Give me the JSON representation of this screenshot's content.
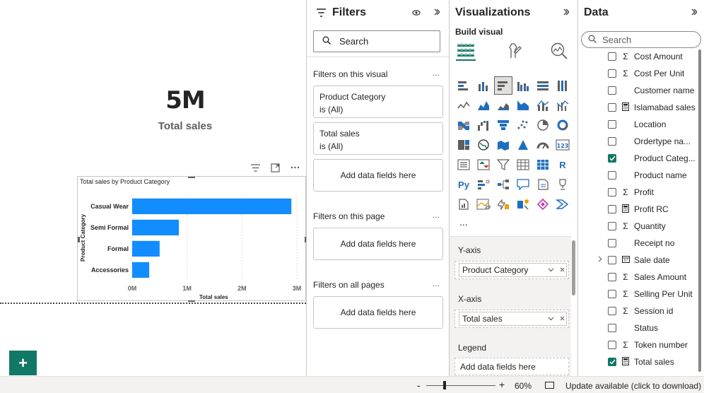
{
  "canvas": {
    "kpi": {
      "value": "5M",
      "label": "Total sales"
    },
    "add_page_label": "+"
  },
  "chart_data": {
    "type": "bar",
    "orientation": "horizontal",
    "title": "Total sales by Product Category",
    "categories": [
      "Casual Wear",
      "Semi Formal",
      "Formal",
      "Accessories"
    ],
    "values": [
      2.9,
      0.85,
      0.5,
      0.31
    ],
    "xlabel": "Total sales",
    "ylabel": "Product Category",
    "xlim": [
      0,
      3
    ],
    "x_ticks": [
      "0M",
      "1M",
      "2M",
      "3M"
    ],
    "bar_color": "#118DFF",
    "grid": true
  },
  "filters": {
    "title": "Filters",
    "search_placeholder": "Search",
    "on_visual_label": "Filters on this visual",
    "cards": [
      {
        "name": "Product Category",
        "state": "is (All)"
      },
      {
        "name": "Total sales",
        "state": "is (All)"
      }
    ],
    "add_fields_label": "Add data fields here",
    "on_page_label": "Filters on this page",
    "on_all_pages_label": "Filters on all pages",
    "more": "..."
  },
  "visualizations": {
    "title": "Visualizations",
    "build_visual_label": "Build visual",
    "more": "...",
    "wells": {
      "y_axis_label": "Y-axis",
      "y_axis_field": "Product Category",
      "x_axis_label": "X-axis",
      "x_axis_field": "Total sales",
      "legend_label": "Legend",
      "legend_placeholder": "Add data fields here"
    }
  },
  "data": {
    "title": "Data",
    "search_placeholder": "Search",
    "fields": [
      {
        "name": "Cost Amount",
        "type": "sum",
        "checked": false,
        "expander": false
      },
      {
        "name": "Cost Per Unit",
        "type": "sum",
        "checked": false,
        "expander": false
      },
      {
        "name": "Customer name",
        "type": "none",
        "checked": false,
        "expander": false
      },
      {
        "name": "Islamabad sales",
        "type": "calc",
        "checked": false,
        "expander": false
      },
      {
        "name": "Location",
        "type": "none",
        "checked": false,
        "expander": false
      },
      {
        "name": "Ordertype na...",
        "type": "none",
        "checked": false,
        "expander": false
      },
      {
        "name": "Product Categ...",
        "type": "none",
        "checked": true,
        "expander": false
      },
      {
        "name": "Product name",
        "type": "none",
        "checked": false,
        "expander": false
      },
      {
        "name": "Profit",
        "type": "sum",
        "checked": false,
        "expander": false
      },
      {
        "name": "Profit RC",
        "type": "calc",
        "checked": false,
        "expander": false
      },
      {
        "name": "Quantity",
        "type": "sum",
        "checked": false,
        "expander": false
      },
      {
        "name": "Receipt no",
        "type": "none",
        "checked": false,
        "expander": false
      },
      {
        "name": "Sale date",
        "type": "calendar",
        "checked": false,
        "expander": true
      },
      {
        "name": "Sales Amount",
        "type": "sum",
        "checked": false,
        "expander": false
      },
      {
        "name": "Selling Per Unit",
        "type": "sum",
        "checked": false,
        "expander": false
      },
      {
        "name": "Session id",
        "type": "sum",
        "checked": false,
        "expander": false
      },
      {
        "name": "Status",
        "type": "none",
        "checked": false,
        "expander": false
      },
      {
        "name": "Token number",
        "type": "sum",
        "checked": false,
        "expander": false
      },
      {
        "name": "Total sales",
        "type": "calc",
        "checked": true,
        "expander": false
      }
    ]
  },
  "statusbar": {
    "zoom_minus": "-",
    "zoom_plus": "+",
    "zoom_level": "60%",
    "update_text": "Update available (click to download)"
  },
  "colors": {
    "accent": "#117865",
    "bar": "#118DFF"
  }
}
